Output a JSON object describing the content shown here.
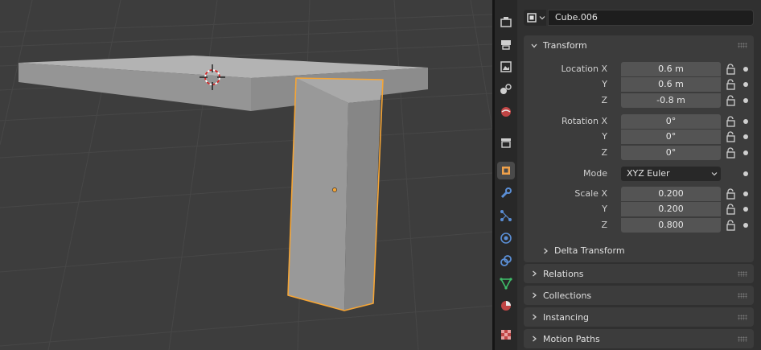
{
  "object": {
    "name": "Cube.006",
    "type_icon": "object-square-icon"
  },
  "transform": {
    "title": "Transform",
    "location": {
      "label": "Location X",
      "y_label": "Y",
      "z_label": "Z",
      "x": "0.6 m",
      "y": "0.6 m",
      "z": "-0.8 m"
    },
    "rotation": {
      "label": "Rotation X",
      "y_label": "Y",
      "z_label": "Z",
      "x": "0°",
      "y": "0°",
      "z": "0°"
    },
    "mode": {
      "label": "Mode",
      "value": "XYZ Euler"
    },
    "scale": {
      "label": "Scale X",
      "y_label": "Y",
      "z_label": "Z",
      "x": "0.200",
      "y": "0.200",
      "z": "0.800"
    },
    "delta": "Delta Transform"
  },
  "panels": {
    "relations": "Relations",
    "collections": "Collections",
    "instancing": "Instancing",
    "motion_paths": "Motion Paths"
  },
  "tabs": [
    "tool-icon",
    "render-icon",
    "output-icon",
    "view-layer-icon",
    "scene-icon",
    "world-icon",
    "collection-icon",
    "object-icon",
    "modifier-icon",
    "particles-icon",
    "physics-icon",
    "constraints-icon",
    "data-icon",
    "material-icon",
    "texture-icon"
  ],
  "colors": {
    "selection_outline": "#f5a536",
    "active_tab_icon": "#f0a14a",
    "viewport_bg": "#3d3d3d",
    "panel_bg": "#303030"
  }
}
